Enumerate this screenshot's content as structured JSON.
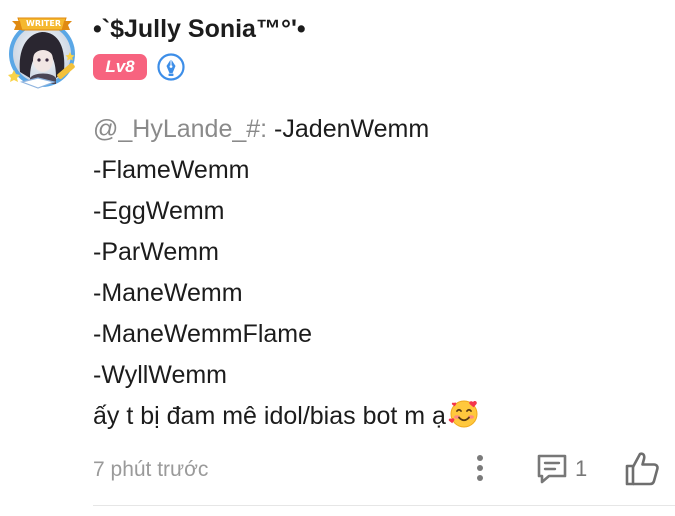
{
  "comment": {
    "author": {
      "name": "•`$Jully Sonia™°'•",
      "avatar_frame_label": "WRITER",
      "level": "Lv8",
      "role_icon": "moderator-pen-icon"
    },
    "mention": "@_HyLande_#:",
    "lines": [
      " -JadenWemm",
      "-FlameWemm",
      "-EggWemm",
      "-ParWemm",
      "-ManeWemm",
      "-ManeWemmFlame",
      "-WyllWemm",
      "ấy t bị đam mê idol/bias bot m ạ"
    ],
    "trailing_emoji": "smiling-face-with-hearts-emoji",
    "timestamp": "7 phút trước",
    "reply_count": "1",
    "icons": {
      "more": "more-vertical-icon",
      "reply": "comment-icon",
      "like": "thumbs-up-icon"
    },
    "colors": {
      "level_badge": "#f7637f",
      "mention": "#8a8a8a",
      "timestamp": "#9a9a9a",
      "role_icon": "#3d8ee8"
    }
  }
}
